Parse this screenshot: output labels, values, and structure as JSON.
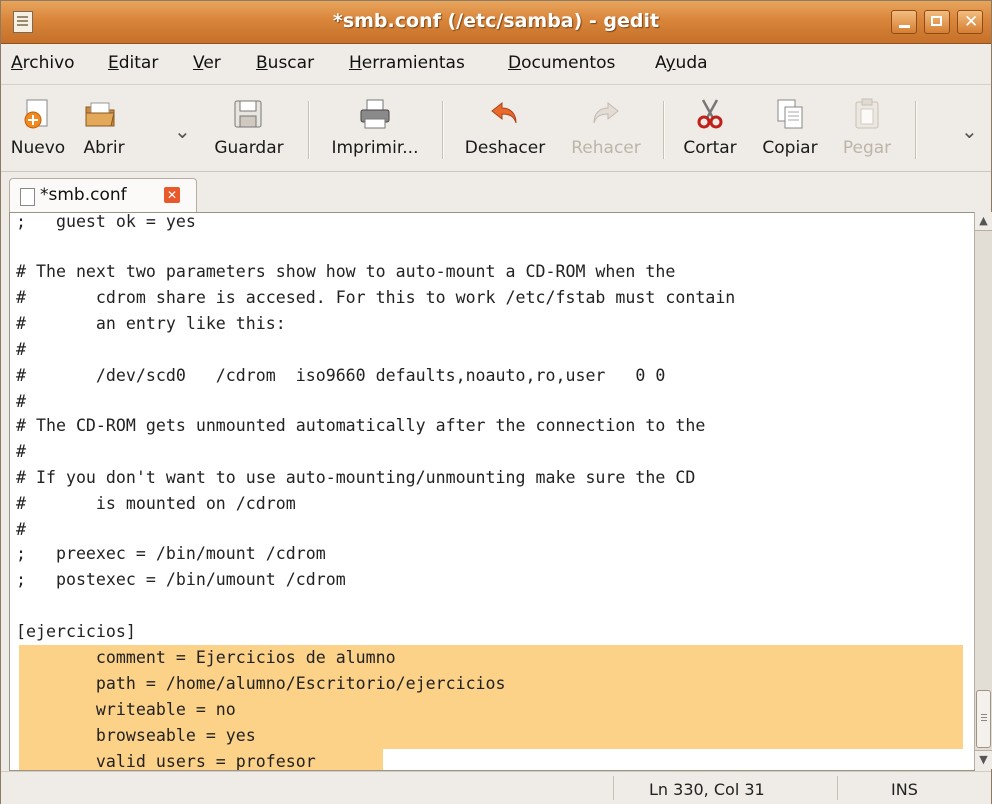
{
  "window": {
    "title": "*smb.conf (/etc/samba) - gedit",
    "controls": {
      "minimize": "minimize-icon",
      "maximize": "maximize-icon",
      "close": "close-icon"
    }
  },
  "menubar": {
    "items": [
      {
        "first": "A",
        "rest": "rchivo"
      },
      {
        "first": "E",
        "rest": "ditar"
      },
      {
        "first": "V",
        "rest": "er"
      },
      {
        "first": "B",
        "rest": "uscar"
      },
      {
        "first": "H",
        "rest": "erramientas"
      },
      {
        "first": "D",
        "rest": "ocumentos"
      },
      {
        "first": "Ay",
        "rest": "uda",
        "underline_index": 1
      }
    ]
  },
  "toolbar": {
    "buttons": [
      {
        "label": "Nuevo",
        "icon": "new-document-icon",
        "enabled": true
      },
      {
        "label": "Abrir",
        "icon": "open-folder-icon",
        "enabled": true
      },
      {
        "label": "Guardar",
        "icon": "save-icon",
        "enabled": true
      },
      {
        "label": "Imprimir...",
        "icon": "print-icon",
        "enabled": true
      },
      {
        "label": "Deshacer",
        "icon": "undo-icon",
        "enabled": true
      },
      {
        "label": "Rehacer",
        "icon": "redo-icon",
        "enabled": false
      },
      {
        "label": "Cortar",
        "icon": "cut-icon",
        "enabled": true
      },
      {
        "label": "Copiar",
        "icon": "copy-icon",
        "enabled": true
      },
      {
        "label": "Pegar",
        "icon": "paste-icon",
        "enabled": false
      }
    ]
  },
  "tabs": [
    {
      "label": "*smb.conf",
      "icon": "document-icon",
      "close_icon": "close-tab-icon"
    }
  ],
  "editor": {
    "lines": [
      ";   guest ok = yes",
      "",
      "# The next two parameters show how to auto-mount a CD-ROM when the",
      "#       cdrom share is accesed. For this to work /etc/fstab must contain",
      "#       an entry like this:",
      "#",
      "#       /dev/scd0   /cdrom  iso9660 defaults,noauto,ro,user   0 0",
      "#",
      "# The CD-ROM gets unmounted automatically after the connection to the",
      "#",
      "# If you don't want to use auto-mounting/unmounting make sure the CD",
      "#       is mounted on /cdrom",
      "#",
      ";   preexec = /bin/mount /cdrom",
      ";   postexec = /bin/umount /cdrom",
      "",
      "[ejercicios]",
      "        comment = Ejercicios de alumno",
      "        path = /home/alumno/Escritorio/ejercicios",
      "        writeable = no",
      "        browseable = yes",
      "        valid users = profesor"
    ],
    "highlight_color": "#fcd188"
  },
  "statusbar": {
    "position": "Ln 330, Col 31",
    "mode": "INS"
  }
}
